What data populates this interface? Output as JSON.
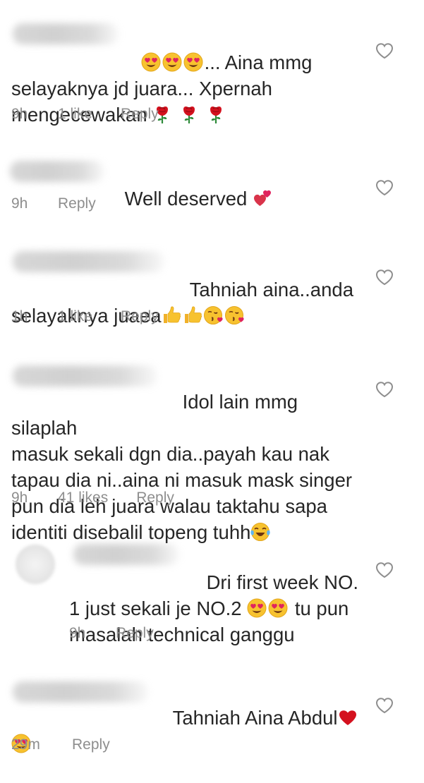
{
  "comments": [
    {
      "text_before": "",
      "text_main": "... Aina mmg",
      "line2": "selayaknya jd juara... Xpernah",
      "line3": "mengecewakan",
      "time": "9h",
      "likes": "1 like",
      "reply": "Reply",
      "emojis_lead": [
        "heart-eyes-emoji",
        "heart-eyes-emoji",
        "heart-eyes-emoji"
      ],
      "emojis_trail": [
        "rose-emoji",
        "rose-emoji",
        "rose-emoji"
      ]
    },
    {
      "text_main": "Well deserved",
      "time": "9h",
      "likes": "",
      "reply": "Reply",
      "emojis_trail": [
        "two-hearts-emoji"
      ]
    },
    {
      "text_main": "Tahniah aina..anda",
      "line2": "selayaknya juaea",
      "time": "1h",
      "likes": "1 like",
      "reply": "Reply",
      "emojis_trail": [
        "thumbs-up-emoji",
        "thumbs-up-emoji",
        "kissing-heart-emoji",
        "kissing-heart-emoji"
      ]
    },
    {
      "text_main": "Idol lain mmg silaplah",
      "line2": "masuk sekali dgn dia..payah kau nak",
      "line3": "tapau dia ni..aina ni masuk mask singer",
      "line4": "pun dia leh juara walau taktahu sapa",
      "line5": "identiti disebalil topeng tuhh",
      "time": "9h",
      "likes": "41 likes",
      "reply": "Reply",
      "emojis_trail": [
        "tears-of-joy-emoji"
      ]
    },
    {
      "text_main": "Dri first week NO.",
      "line2a": "1 just sekali je NO.2",
      "line2b": "tu pun",
      "line3": "masalah technical ganggu",
      "time": "9h",
      "likes": "",
      "reply": "Reply",
      "emojis_mid": [
        "heart-eyes-emoji",
        "heart-eyes-emoji"
      ]
    },
    {
      "text_main": "Tahniah Aina Abdul",
      "time": "29m",
      "likes": "",
      "reply": "Reply",
      "emojis_trail": [
        "red-heart-emoji"
      ],
      "emojis_line2": [
        "heart-eyes-emoji"
      ]
    }
  ],
  "colors": {
    "text": "#262626",
    "meta": "#8e8e8e",
    "heart_outline": "#8e8e8e",
    "emoji_yellow": "#f7c22f",
    "emoji_heart": "#e0245e",
    "rose_red": "#d4111e",
    "rose_green": "#2e8b3a"
  }
}
